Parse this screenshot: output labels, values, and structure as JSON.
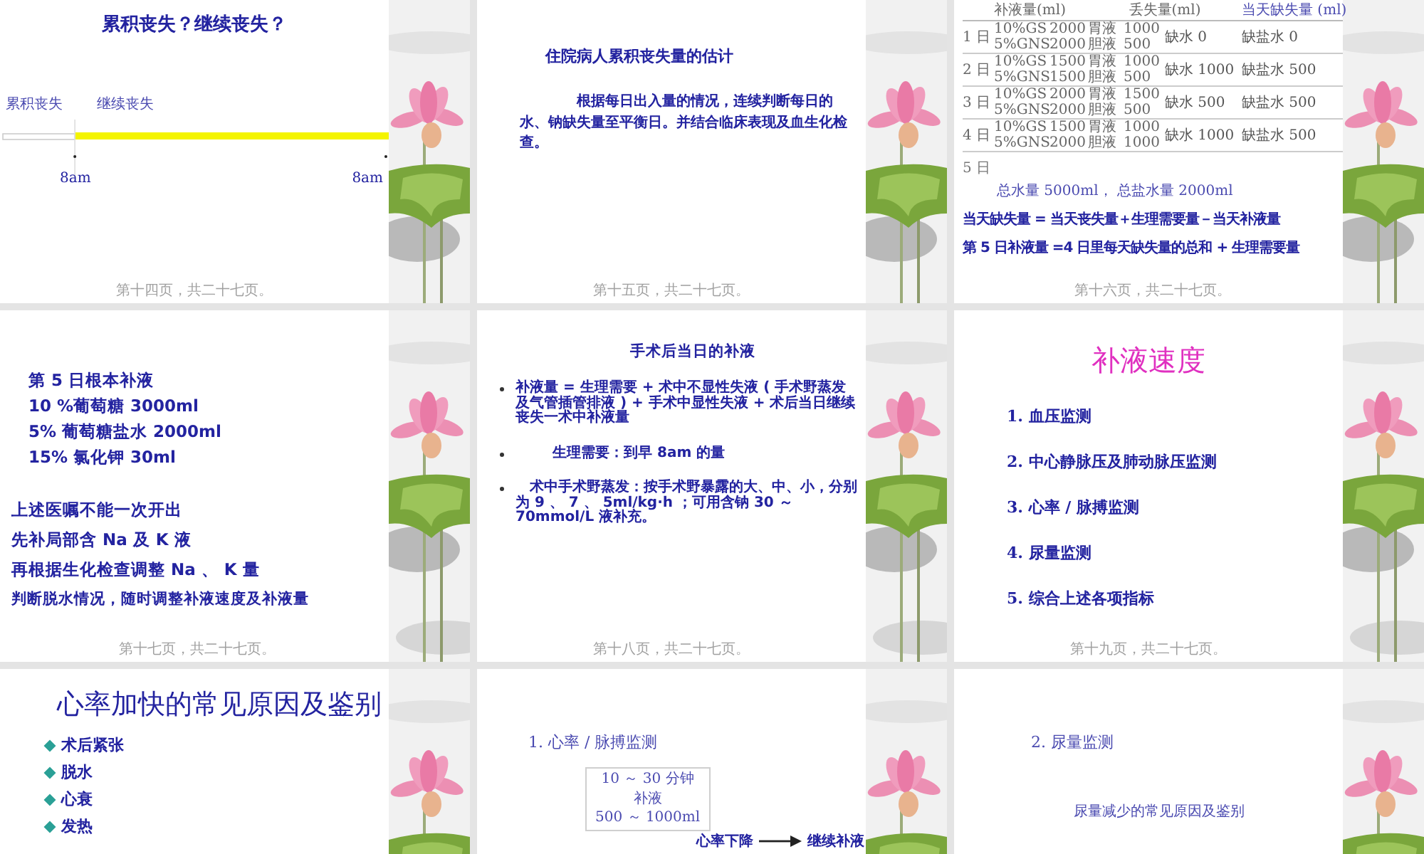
{
  "slides": [
    {
      "kind": "timeline",
      "title": "累积丧失？继续丧失？",
      "left_label": "累积丧失",
      "right_label": "继续丧失",
      "start_time": "8am",
      "end_time": "8am",
      "page_label": "第十四页，共二十七页。"
    },
    {
      "kind": "text",
      "title": "住院病人累积丧失量的估计",
      "paragraph": "根据每日出入量的情况，连续判断每日的水、钠缺失量至平衡日。并结合临床表现及血生化检查。",
      "page_label": "第十五页，共二十七页。"
    },
    {
      "kind": "table",
      "columns": [
        "补液量(ml)",
        "丢失量(ml)",
        "当天缺失量 (ml)"
      ],
      "rows": [
        {
          "day": "1 日",
          "infusions": [
            [
              "10%GS",
              "2000"
            ],
            [
              "5%GNS",
              "2000"
            ]
          ],
          "losses": [
            [
              "胃液",
              "1000"
            ],
            [
              "胆液",
              "500"
            ]
          ],
          "water": "缺水 0",
          "salt": "缺盐水 0"
        },
        {
          "day": "2 日",
          "infusions": [
            [
              "10%GS",
              "1500"
            ],
            [
              "5%GNS",
              "1500"
            ]
          ],
          "losses": [
            [
              "胃液",
              "1000"
            ],
            [
              "胆液",
              "500"
            ]
          ],
          "water": "缺水 1000",
          "salt": "缺盐水 500"
        },
        {
          "day": "3 日",
          "infusions": [
            [
              "10%GS",
              "2000"
            ],
            [
              "5%GNS",
              "2000"
            ]
          ],
          "losses": [
            [
              "胃液",
              "1500"
            ],
            [
              "胆液",
              "500"
            ]
          ],
          "water": "缺水 500",
          "salt": "缺盐水 500"
        },
        {
          "day": "4 日",
          "infusions": [
            [
              "10%GS",
              "1500"
            ],
            [
              "5%GNS",
              "2000"
            ]
          ],
          "losses": [
            [
              "胃液",
              "1000"
            ],
            [
              "胆液",
              "1000"
            ]
          ],
          "water": "缺水 1000",
          "salt": "缺盐水 500"
        }
      ],
      "extra_day": "5 日",
      "totals": "总水量 5000ml， 总盐水量 2000ml",
      "formulas": [
        "当天缺失量 = 当天丧失量＋生理需要量－当天补液量",
        "第 5 日补液量 =4 日里每天缺失量的总和 + 生理需要量"
      ],
      "page_label": "第十六页，共二十七页。"
    },
    {
      "kind": "lines",
      "groups": [
        [
          "第 5 日根本补液",
          "10 %葡萄糖   3000ml",
          "5% 葡萄糖盐水   2000ml",
          "15% 氯化钾   30ml"
        ],
        [
          "上述医嘱不能一次开出",
          "先补局部含 **Na** 及 **K** 液",
          "再根据生化检查调整 **Na** 、 **K** 量",
          "判断脱水情况，随时调整补液速度及补液量"
        ]
      ],
      "page_label": "第十七页，共二十七页。"
    },
    {
      "kind": "bullets",
      "title": "手术后当日的补液",
      "bullets": [
        "补液量 = 生理需要 + 术中不显性失液 ( 手术野蒸发及气管插管排液 ) + 手术中显性失液 + 术后当日继续丧失一术中补液量",
        "生理需要：到早 8am 的量",
        "术中手术野蒸发：按手术野暴露的大、中、小，分别为 9 、 7 、 5ml/kg·h ；可用含钠 30 ～ 70mmol/L 液补充。"
      ],
      "page_label": "第十八页，共二十七页。"
    },
    {
      "kind": "numbered",
      "title": "补液速度",
      "items": [
        "1. 血压监测",
        "2. 中心静脉压及肺动脉压监测",
        "3. 心率 / 脉搏监测",
        "4. 尿量监测",
        "5. 综合上述各项指标"
      ],
      "page_label": "第十九页，共二十七页。"
    },
    {
      "kind": "diamonds",
      "title": "心率加快的常见原因及鉴别",
      "items": [
        "术后紧张",
        "脱水",
        "心衰",
        "发热"
      ]
    },
    {
      "kind": "monitor",
      "heading": "1. 心率 / 脉搏监测",
      "box_lines": [
        "10 ～ 30 分钟",
        "补液",
        "500 ～ 1000ml"
      ],
      "result": "心率下降",
      "action": "继续补液"
    },
    {
      "kind": "subtitle",
      "heading": "2. 尿量监测",
      "text": "尿量减少的常见原因及鉴别"
    }
  ]
}
